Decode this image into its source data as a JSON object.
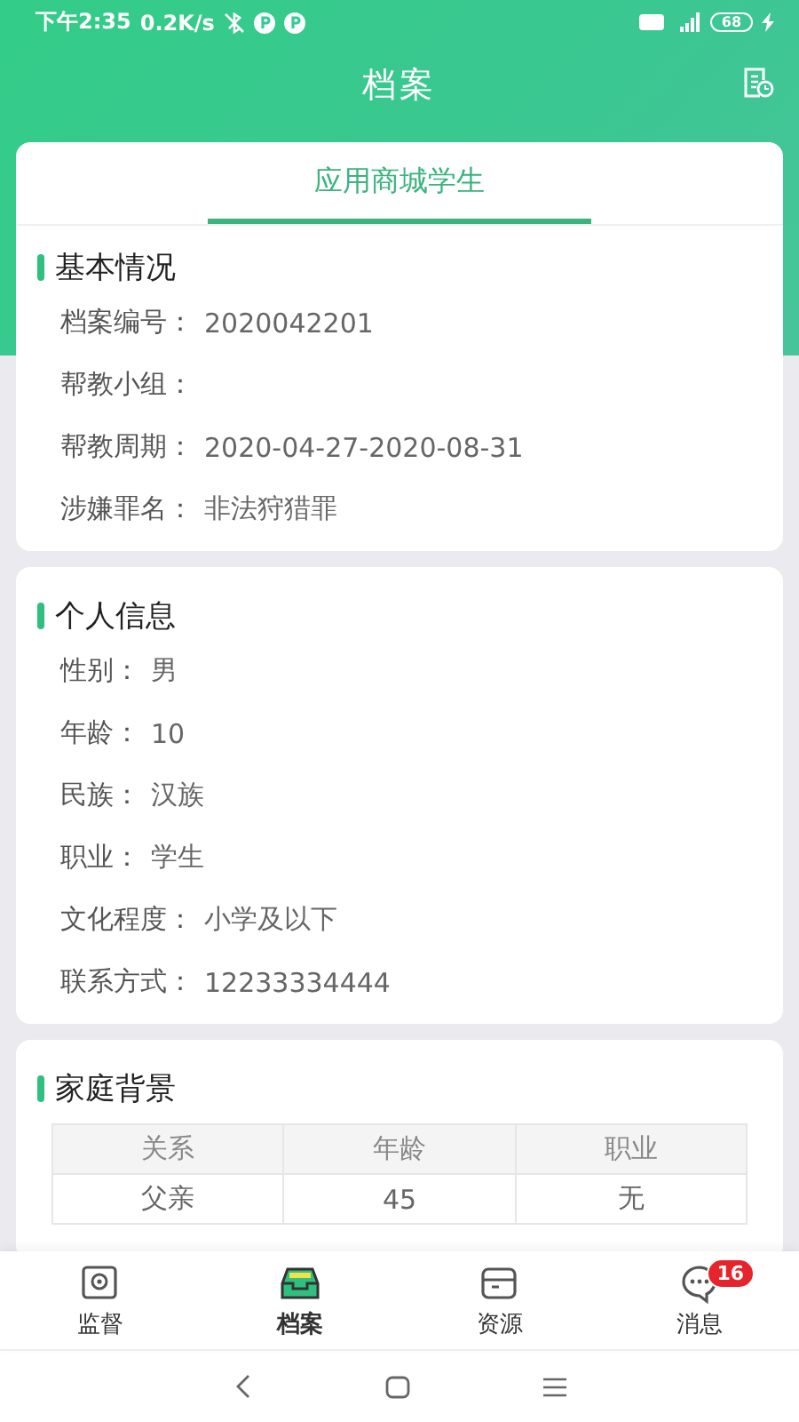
{
  "status_bar": {
    "time": "下午2:35",
    "speed": "0.2K/s",
    "battery": "68"
  },
  "header": {
    "title": "档案"
  },
  "tabs": [
    {
      "label": "应用商城学生",
      "selected": true
    }
  ],
  "sections": [
    {
      "title": "基本情况",
      "fields": [
        {
          "label": "档案编号：",
          "value": "2020042201"
        },
        {
          "label": "帮教小组："
        },
        {
          "label": "帮教周期：",
          "value": "2020-04-27-2020-08-31"
        },
        {
          "label": "涉嫌罪名：",
          "value": "非法狩猎罪"
        }
      ]
    },
    {
      "title": "个人信息",
      "fields": [
        {
          "label": "性别：",
          "value": "男"
        },
        {
          "label": "年龄：",
          "value": "10"
        },
        {
          "label": "民族：",
          "value": "汉族"
        },
        {
          "label": "职业：",
          "value": "学生"
        },
        {
          "label": "文化程度：",
          "value": "小学及以下"
        },
        {
          "label": "联系方式：",
          "value": "12233334444"
        }
      ]
    },
    {
      "title": "家庭背景",
      "table": {
        "columns": [
          "关系",
          "年龄",
          "职业"
        ],
        "rows": [
          [
            "父亲",
            "45",
            "无"
          ]
        ]
      }
    }
  ],
  "bottom_nav": [
    {
      "kind": "monitor",
      "label": "监督",
      "selected": false
    },
    {
      "kind": "archive",
      "label": "档案",
      "selected": true
    },
    {
      "kind": "resource",
      "label": "资源",
      "selected": false
    },
    {
      "kind": "message",
      "label": "消息",
      "selected": false,
      "badge": "16"
    }
  ]
}
